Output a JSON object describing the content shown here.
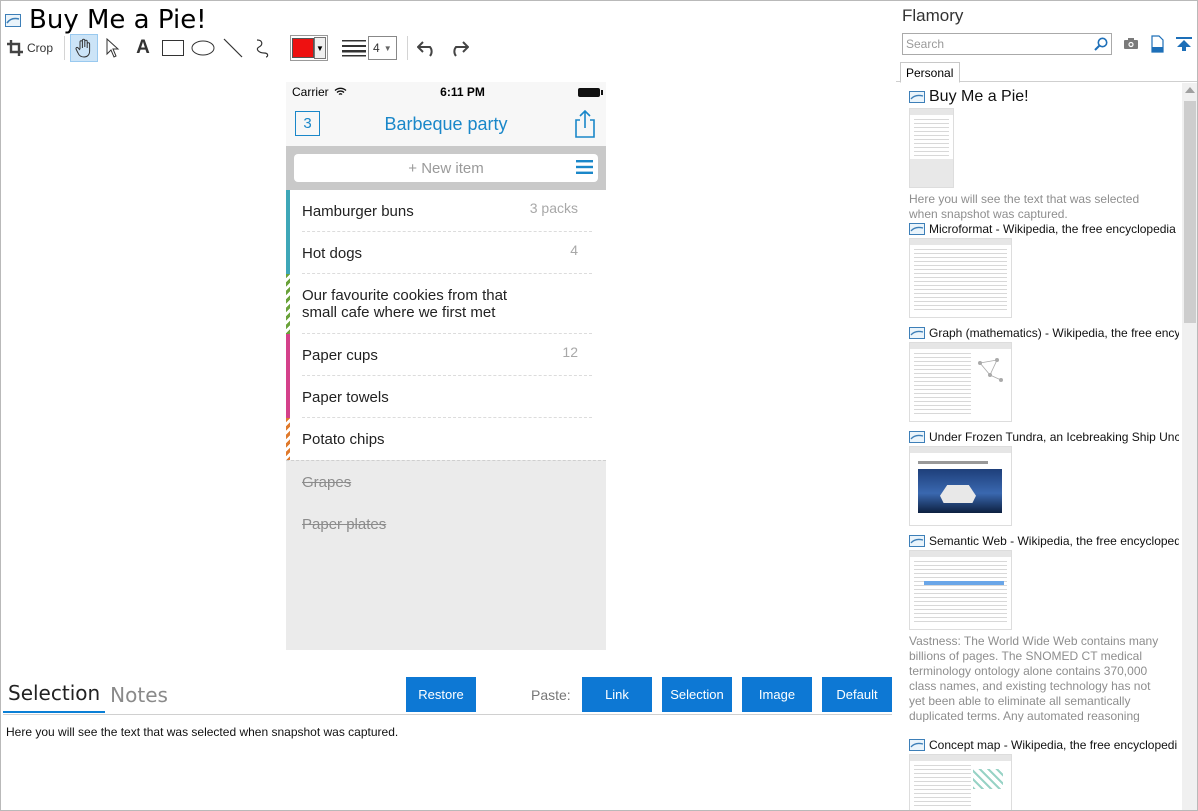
{
  "window": {
    "title": "Buy Me a Pie!"
  },
  "toolbar": {
    "crop_label": "Crop",
    "line_width": "4",
    "color": "#ee1111"
  },
  "phone": {
    "carrier": "Carrier",
    "time": "6:11 PM",
    "list_count": "3",
    "list_title": "Barbeque party",
    "new_item_placeholder": "+ New item",
    "items": [
      {
        "name": "Hamburger buns",
        "qty": "3 packs",
        "color": "#3ea7b8"
      },
      {
        "name": "Hot dogs",
        "qty": "4",
        "color": "#3ea7b8"
      },
      {
        "name": "Our favourite cookies from that small cafe where we first met",
        "qty": "",
        "color": "#6aa23a"
      },
      {
        "name": "Paper cups",
        "qty": "12",
        "color": "#d4418a"
      },
      {
        "name": "Paper towels",
        "qty": "",
        "color": "#d4418a"
      },
      {
        "name": "Potato chips",
        "qty": "",
        "color": "#e07a2c"
      }
    ],
    "done_items": [
      "Grapes",
      "Paper plates"
    ]
  },
  "bottom": {
    "tabs": [
      "Selection",
      "Notes"
    ],
    "restore_label": "Restore",
    "paste_label": "Paste:",
    "paste_buttons": [
      "Link",
      "Selection",
      "Image",
      "Default"
    ],
    "selection_text": "Here you will see the text that was selected when snapshot was captured."
  },
  "sidebar": {
    "title": "Flamory",
    "search_placeholder": "Search",
    "tab_label": "Personal",
    "snapshots": [
      {
        "title": "Buy Me a Pie!",
        "description": "Here you will see the text that was selected when snapshot was captured."
      },
      {
        "title": "Microformat - Wikipedia, the free encyclopedia",
        "description": ""
      },
      {
        "title": "Graph (mathematics) - Wikipedia, the free ency",
        "description": ""
      },
      {
        "title": "Under Frozen Tundra, an Icebreaking Ship Unco",
        "description": ""
      },
      {
        "title": "Semantic Web - Wikipedia, the free encycloped",
        "description": "Vastness: The World Wide Web contains many billions of pages. The SNOMED CT medical terminology ontology alone contains 370,000 class names, and existing technology has not yet been able to eliminate all semantically duplicated terms. Any automated reasoning system will have to deal with truly huge inputs."
      },
      {
        "title": "Concept map - Wikipedia, the free encyclopedi",
        "description": ""
      }
    ]
  },
  "colors": {
    "accent": "#0d78d4",
    "phone_accent": "#1a87c9"
  }
}
